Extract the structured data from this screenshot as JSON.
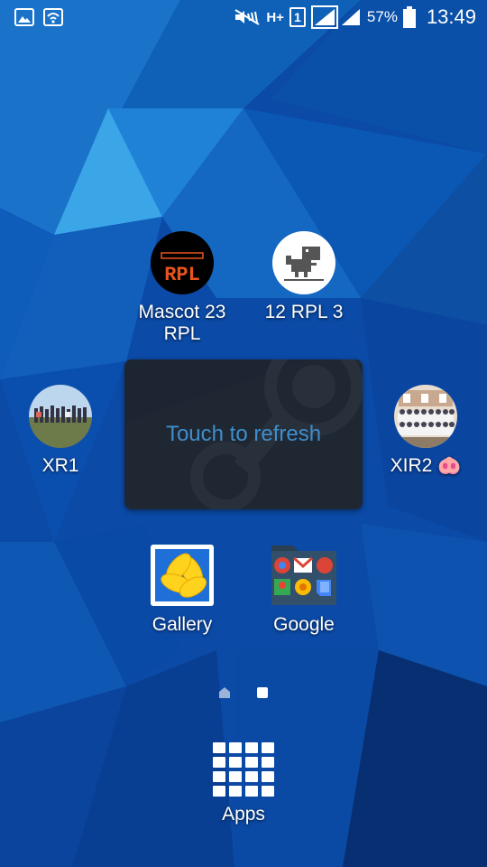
{
  "status_bar": {
    "network_type": "H+",
    "sim_slot": "1",
    "battery_percent": "57%",
    "time": "13:49",
    "icons": [
      "gallery-notification-icon",
      "wifi-icon",
      "mute-icon",
      "network-type-icon",
      "sim-icon",
      "signal-strength-icon",
      "battery-icon"
    ]
  },
  "home": {
    "apps": {
      "mascot": {
        "label": "Mascot 23\nRPL",
        "logo_text": "RPL"
      },
      "rpl3": {
        "label": "12 RPL 3"
      },
      "xr1": {
        "label": "XR1"
      },
      "xir2": {
        "label": "XIR2 🐽"
      },
      "gallery": {
        "label": "Gallery"
      },
      "google": {
        "label": "Google"
      }
    },
    "widget": {
      "text": "Touch to refresh"
    },
    "page_indicator": {
      "pages": 2,
      "current": 2
    },
    "apps_button": {
      "label": "Apps"
    }
  },
  "colors": {
    "wallpaper": "#0b4aa6",
    "widget_bg": "#1c2531",
    "widget_text": "#3f8ecb"
  }
}
